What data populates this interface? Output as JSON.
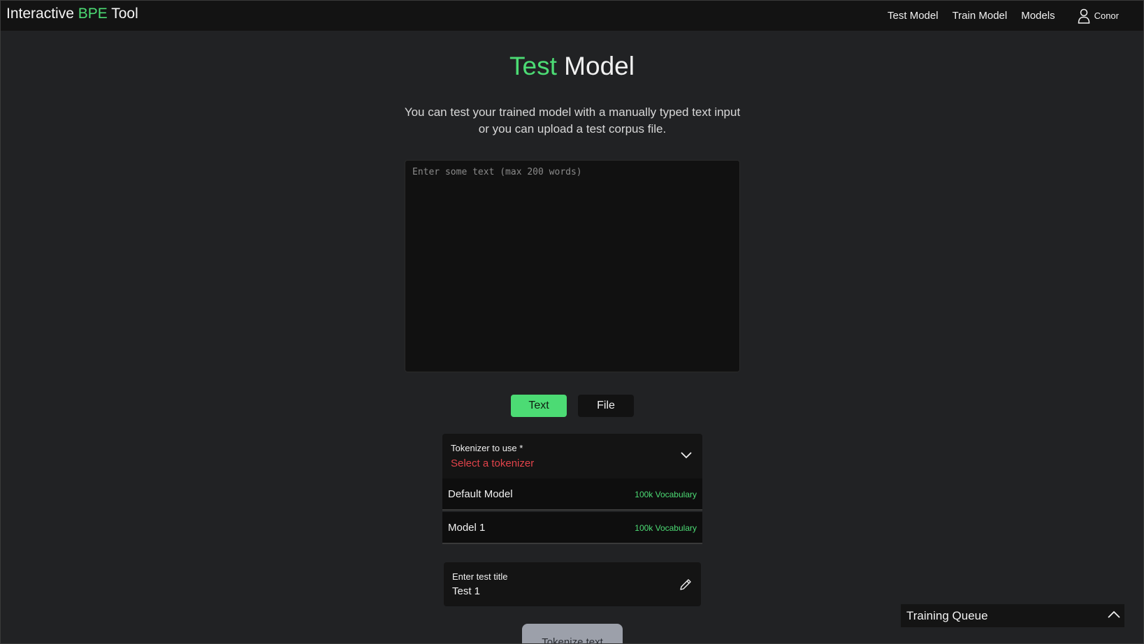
{
  "navbar": {
    "brand_prefix": "Interactive ",
    "brand_accent": "BPE",
    "brand_suffix": " Tool",
    "links": [
      "Test Model",
      "Train Model",
      "Models"
    ],
    "user_name": "Conor",
    "user_icon": "user-icon"
  },
  "main": {
    "title_accent": "Test",
    "title_rest": " Model",
    "subtitle_line1": "You can test your trained model with a manually typed text input",
    "subtitle_line2": "or you can upload a test corpus file.",
    "textarea_placeholder": "Enter some text (max 200 words)",
    "textarea_value": "",
    "mode_buttons": {
      "text": "Text",
      "file": "File",
      "active": "Text"
    },
    "tokenizer_select": {
      "label": "Tokenizer to use *",
      "placeholder": "Select a tokenizer",
      "options": [
        {
          "name": "Default Model",
          "vocab": "100k Vocabulary"
        },
        {
          "name": "Model 1",
          "vocab": "100k Vocabulary"
        }
      ]
    },
    "test_title": {
      "label": "Enter test title",
      "value": "Test 1"
    },
    "tokenize_button": "Tokenize text"
  },
  "training_queue": {
    "title": "Training Queue"
  },
  "colors": {
    "accent": "#4cdb74",
    "error": "#e2434a",
    "background": "#212224",
    "navbar": "#131313"
  }
}
